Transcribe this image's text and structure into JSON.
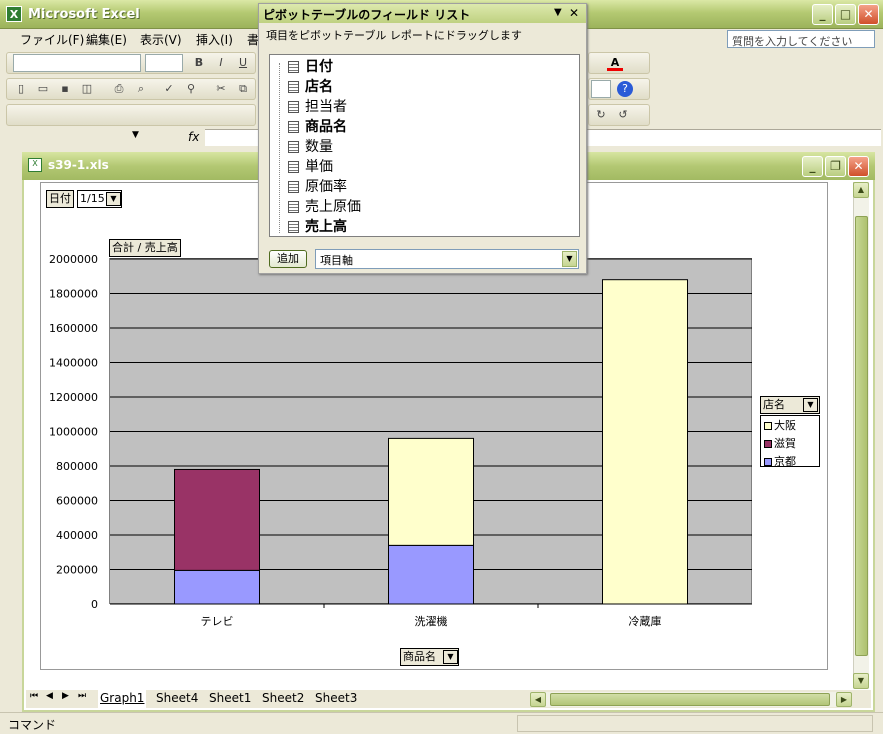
{
  "app": {
    "title": "Microsoft Excel",
    "excel_icon": "excel-icon",
    "help_placeholder": "質問を入力してください"
  },
  "menu": [
    "ファイル(F)",
    "編集(E)",
    "表示(V)",
    "挿入(I)",
    "書"
  ],
  "formula": {
    "fx": "fx"
  },
  "workbook": {
    "title": "s39-1.xls"
  },
  "pivot": {
    "page_field": "日付",
    "page_value": "1/15",
    "data_field": "合計 / 売上高",
    "category_field": "商品名",
    "series_field": "店名"
  },
  "field_list": {
    "title": "ピボットテーブルのフィールド リスト",
    "instruction": "項目をピボットテーブル レポートにドラッグします",
    "fields": [
      "日付",
      "店名",
      "担当者",
      "商品名",
      "数量",
      "単価",
      "原価率",
      "売上原価",
      "売上高"
    ],
    "bold_fields": [
      0,
      1,
      3,
      8
    ],
    "add_button": "追加",
    "target": "項目軸"
  },
  "colors": {
    "osaka": "#ffffcc",
    "shiga": "#993366",
    "kyoto": "#9999ff",
    "plot_bg": "#c0c0c0"
  },
  "chart_data": {
    "type": "bar",
    "stacked": true,
    "categories": [
      "テレビ",
      "洗濯機",
      "冷蔵庫"
    ],
    "series": [
      {
        "name": "京都",
        "values": [
          195000,
          340000,
          0
        ]
      },
      {
        "name": "滋賀",
        "values": [
          585000,
          0,
          0
        ]
      },
      {
        "name": "大阪",
        "values": [
          0,
          620000,
          1880000
        ]
      }
    ],
    "ylim": [
      0,
      2000000
    ],
    "yticks": [
      "2000000",
      "1800000",
      "1600000",
      "1400000",
      "1200000",
      "1000000",
      "800000",
      "600000",
      "400000",
      "200000",
      "0"
    ],
    "legend_order": [
      "大阪",
      "滋賀",
      "京都"
    ],
    "grid": true,
    "legend": "right"
  },
  "sheets": [
    "Graph1",
    "Sheet4",
    "Sheet1",
    "Sheet2",
    "Sheet3"
  ],
  "status": "コマンド"
}
